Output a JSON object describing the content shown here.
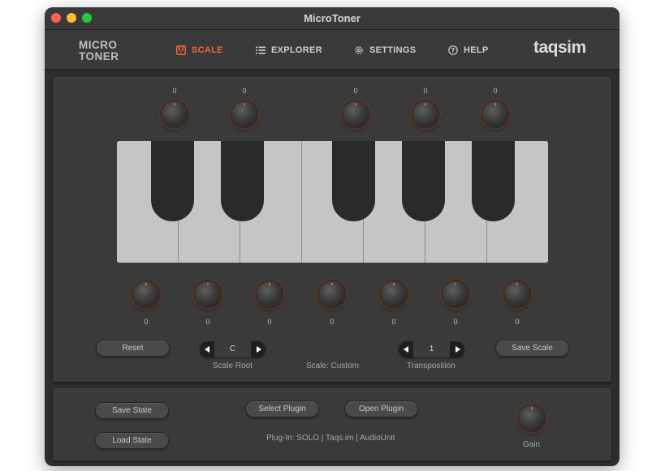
{
  "window": {
    "title": "MicroToner"
  },
  "logo": {
    "line1": "MICRO",
    "line2": "TONER"
  },
  "nav": [
    {
      "label": "SCALE",
      "icon": "piano-keys-icon",
      "active": true
    },
    {
      "label": "EXPLORER",
      "icon": "list-icon",
      "active": false
    },
    {
      "label": "SETTINGS",
      "icon": "gear-icon",
      "active": false
    },
    {
      "label": "HELP",
      "icon": "question-icon",
      "active": false
    }
  ],
  "brand": "taqsim",
  "colors": {
    "accent": "#ee6a3c",
    "panel": "#3a3a3a",
    "background": "#2d2d2d"
  },
  "scale": {
    "top_knobs": [
      {
        "value": "0"
      },
      {
        "value": "0"
      },
      {
        "value": "0"
      },
      {
        "value": "0"
      },
      {
        "value": "0"
      }
    ],
    "bottom_knobs": [
      {
        "value": "0"
      },
      {
        "value": "0"
      },
      {
        "value": "0"
      },
      {
        "value": "0"
      },
      {
        "value": "0"
      },
      {
        "value": "0"
      },
      {
        "value": "0"
      }
    ],
    "reset_label": "Reset",
    "scale_root": {
      "value": "C",
      "label": "Scale Root"
    },
    "scale_name": "Scale: Custom",
    "transposition": {
      "value": "1",
      "label": "Transposition"
    },
    "save_scale_label": "Save Scale"
  },
  "bottom": {
    "save_state_label": "Save State",
    "load_state_label": "Load State",
    "select_plugin_label": "Select Plugin",
    "open_plugin_label": "Open Plugin",
    "plugin_info": "Plug-In: SOLO | Taqs.im | AudioUnit",
    "gain_label": "Gain"
  }
}
